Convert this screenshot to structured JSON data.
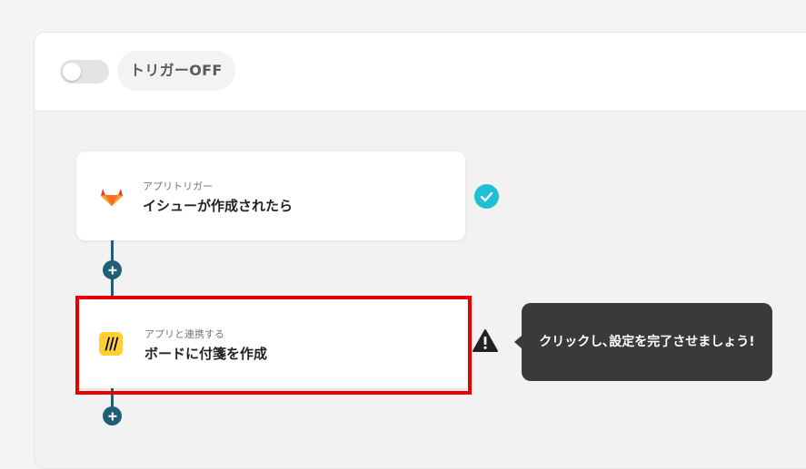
{
  "header": {
    "trigger_status_label": "トリガーOFF",
    "trigger_enabled": false
  },
  "flow": {
    "steps": [
      {
        "caption": "アプリトリガー",
        "title": "イシューが作成されたら",
        "app_icon": "gitlab-icon",
        "status": "complete",
        "status_icon": "check-circle-icon"
      },
      {
        "caption": "アプリと連携する",
        "title": "ボードに付箋を作成",
        "app_icon": "miro-icon",
        "status": "incomplete",
        "status_icon": "warning-icon"
      }
    ]
  },
  "tooltip": {
    "text": "クリックし､設定を完了させましょう!"
  },
  "colors": {
    "connector": "#1e5f74",
    "check": "#1fbfd6",
    "highlight": "#e60000",
    "tooltip_bg": "#3a3a3a"
  }
}
